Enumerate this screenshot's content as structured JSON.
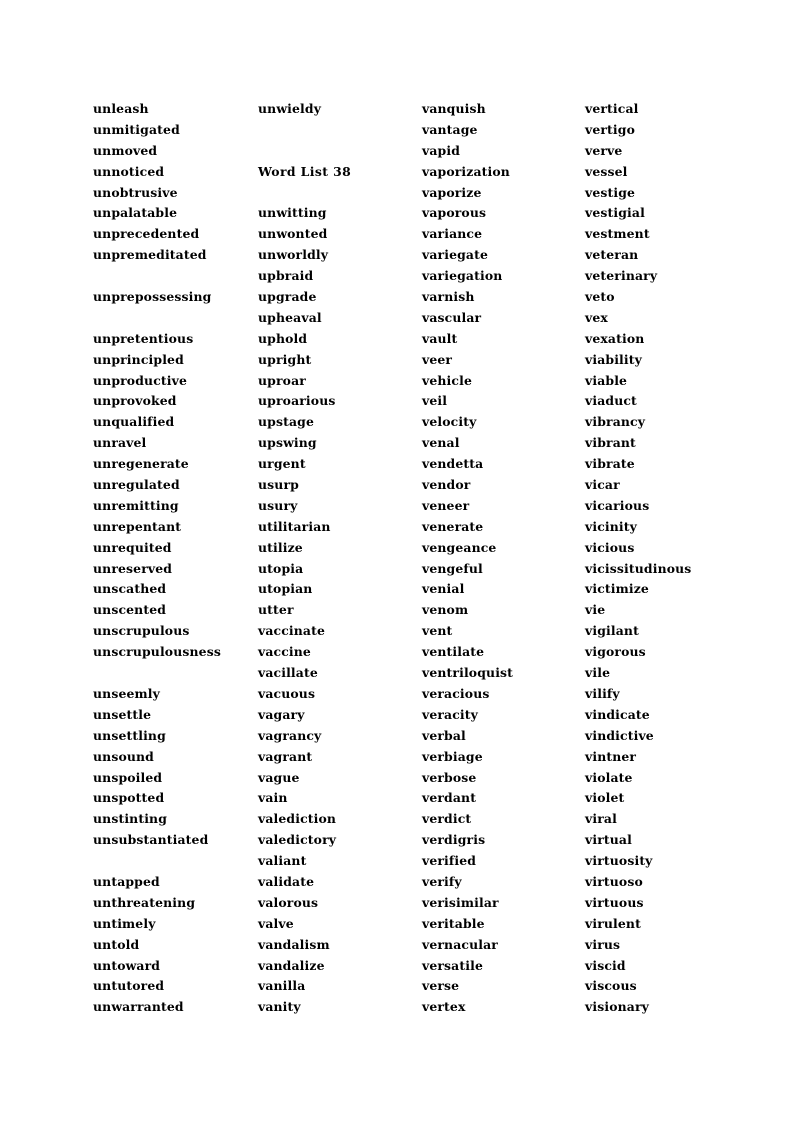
{
  "document": {
    "title": "Word List 38",
    "page_background": "#ffffff",
    "text_color": "#000000",
    "columns_count": 4,
    "rows_count": 44
  },
  "columns": [
    {
      "index": 1,
      "entries": [
        "unleash",
        "unmitigated",
        "unmoved",
        "unnoticed",
        "unobtrusive",
        "unpalatable",
        "unprecedented",
        "unpremeditated",
        "",
        "unprepossessing",
        "",
        "unpretentious",
        "unprincipled",
        "unproductive",
        "unprovoked",
        "unqualified",
        "unravel",
        "unregenerate",
        "unregulated",
        "unremitting",
        "unrepentant",
        "unrequited",
        "unreserved",
        "unscathed",
        "unscented",
        "unscrupulous",
        "unscrupulousness",
        "",
        "unseemly",
        "unsettle",
        "unsettling",
        "unsound",
        "unspoiled",
        "unspotted",
        "unstinting",
        "unsubstantiated",
        "",
        "untapped",
        "unthreatening",
        "untimely",
        "untold",
        "untoward",
        "untutored",
        "unwarranted"
      ]
    },
    {
      "index": 2,
      "entries": [
        "unwieldy",
        "",
        "",
        "Word List 38",
        "",
        "unwitting",
        "unwonted",
        "unworldly",
        "upbraid",
        "upgrade",
        "upheaval",
        "uphold",
        "upright",
        "uproar",
        "uproarious",
        "upstage",
        "upswing",
        "urgent",
        "usurp",
        "usury",
        "utilitarian",
        "utilize",
        "utopia",
        "utopian",
        "utter",
        "vaccinate",
        "vaccine",
        "vacillate",
        "vacuous",
        "vagary",
        "vagrancy",
        "vagrant",
        "vague",
        "vain",
        "valediction",
        "valedictory",
        "valiant",
        "validate",
        "valorous",
        "valve",
        "vandalism",
        "vandalize",
        "vanilla",
        "vanity"
      ]
    },
    {
      "index": 3,
      "entries": [
        "vanquish",
        "vantage",
        "vapid",
        "vaporization",
        "vaporize",
        "vaporous",
        "variance",
        "variegate",
        "variegation",
        "varnish",
        "vascular",
        "vault",
        "veer",
        "vehicle",
        "veil",
        "velocity",
        "venal",
        "vendetta",
        "vendor",
        "veneer",
        "venerate",
        "vengeance",
        "vengeful",
        "venial",
        "venom",
        "vent",
        "ventilate",
        "ventriloquist",
        "veracious",
        "veracity",
        "verbal",
        "verbiage",
        "verbose",
        "verdant",
        "verdict",
        "verdigris",
        "verified",
        "verify",
        "verisimilar",
        "veritable",
        "vernacular",
        "versatile",
        "verse",
        "vertex"
      ]
    },
    {
      "index": 4,
      "entries": [
        "vertical",
        "vertigo",
        "verve",
        "vessel",
        "vestige",
        "vestigial",
        "vestment",
        "veteran",
        "veterinary",
        "veto",
        "vex",
        "vexation",
        "viability",
        "viable",
        "viaduct",
        "vibrancy",
        "vibrant",
        "vibrate",
        "vicar",
        "vicarious",
        "vicinity",
        "vicious",
        "vicissitudinous",
        "victimize",
        "vie",
        "vigilant",
        "vigorous",
        "vile",
        "vilify",
        "vindicate",
        "vindictive",
        "vintner",
        "violate",
        "violet",
        "viral",
        "virtual",
        "virtuosity",
        "virtuoso",
        "virtuous",
        "virulent",
        "virus",
        "viscid",
        "viscous",
        "visionary"
      ]
    }
  ]
}
